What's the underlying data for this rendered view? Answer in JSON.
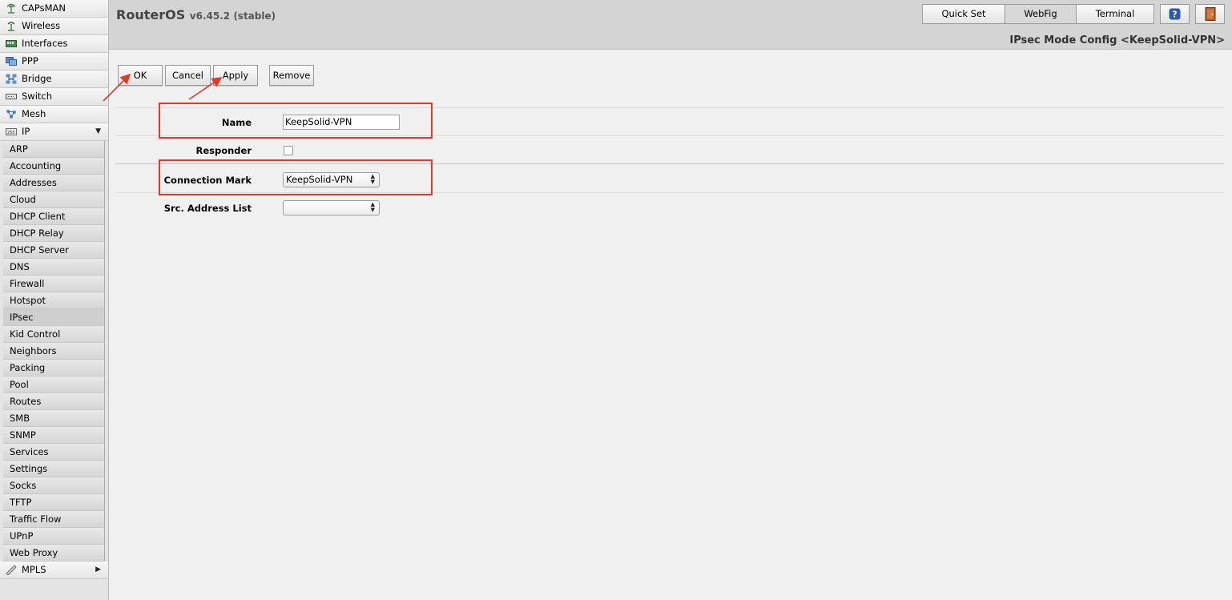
{
  "app": {
    "name": "RouterOS",
    "version": "v6.45.2 (stable)"
  },
  "top_nav": {
    "quick_set": "Quick Set",
    "webfig": "WebFig",
    "terminal": "Terminal",
    "help_icon": "help-icon",
    "logout_icon": "logout-door-icon"
  },
  "page_title": "IPsec Mode Config <KeepSolid-VPN>",
  "sidebar": {
    "top_items": [
      {
        "label": "CAPsMAN",
        "icon": "capsman-icon"
      },
      {
        "label": "Wireless",
        "icon": "wireless-icon"
      },
      {
        "label": "Interfaces",
        "icon": "interfaces-icon"
      },
      {
        "label": "PPP",
        "icon": "ppp-icon"
      },
      {
        "label": "Bridge",
        "icon": "bridge-icon"
      },
      {
        "label": "Switch",
        "icon": "switch-icon"
      },
      {
        "label": "Mesh",
        "icon": "mesh-icon"
      },
      {
        "label": "IP",
        "icon": "ip-icon",
        "expanded": true
      }
    ],
    "ip_subitems": [
      "ARP",
      "Accounting",
      "Addresses",
      "Cloud",
      "DHCP Client",
      "DHCP Relay",
      "DHCP Server",
      "DNS",
      "Firewall",
      "Hotspot",
      "IPsec",
      "Kid Control",
      "Neighbors",
      "Packing",
      "Pool",
      "Routes",
      "SMB",
      "SNMP",
      "Services",
      "Settings",
      "Socks",
      "TFTP",
      "Traffic Flow",
      "UPnP",
      "Web Proxy"
    ],
    "active_subitem": "IPsec",
    "bottom_item": {
      "label": "MPLS",
      "icon": "mpls-icon"
    }
  },
  "toolbar": {
    "ok": "OK",
    "cancel": "Cancel",
    "apply": "Apply",
    "remove": "Remove"
  },
  "form": {
    "name": {
      "label": "Name",
      "value": "KeepSolid-VPN"
    },
    "responder": {
      "label": "Responder",
      "checked": false
    },
    "connection_mark": {
      "label": "Connection Mark",
      "value": "KeepSolid-VPN"
    },
    "src_address_list": {
      "label": "Src. Address List",
      "value": ""
    }
  },
  "colors": {
    "annotation": "#e03a2a",
    "header_bg": "#d4d4d4",
    "title_text": "#444444"
  }
}
